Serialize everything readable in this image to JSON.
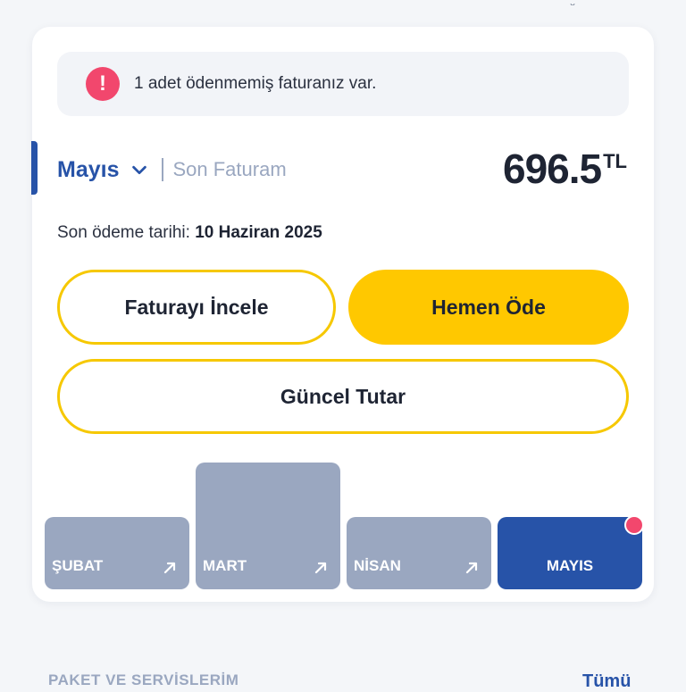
{
  "alert": {
    "icon": "exclamation-icon",
    "icon_glyph": "!",
    "text": "1 adet ödenmemiş faturanız var."
  },
  "bill": {
    "month": "Mayıs",
    "last_bill_label": "Son Faturam",
    "amount": "696.5",
    "currency": "TL",
    "due_label": "Son ödeme tarihi:",
    "due_date": "10 Haziran 2025"
  },
  "buttons": {
    "review": "Faturayı İncele",
    "pay": "Hemen Öde",
    "current": "Güncel Tutar"
  },
  "history": [
    {
      "label": "ŞUBAT",
      "relative_amount": 0.57,
      "active": false
    },
    {
      "label": "MART",
      "relative_amount": 1.0,
      "active": false
    },
    {
      "label": "NİSAN",
      "relative_amount": 0.57,
      "active": false
    },
    {
      "label": "MAYIS",
      "relative_amount": 0.57,
      "active": true
    }
  ],
  "footer": {
    "section_label": "PAKET VE SERVİSLERİM",
    "link": "Tümü"
  },
  "colors": {
    "brand_blue": "#2753a8",
    "accent_yellow": "#ffc800",
    "alert_pink": "#f2476d",
    "bar_inactive": "#9aa7c0"
  }
}
